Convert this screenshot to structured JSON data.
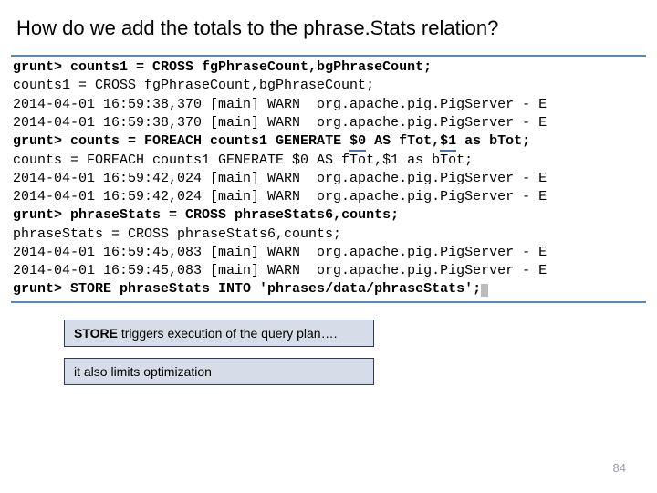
{
  "title": "How do we add the totals to the phrase.Stats relation?",
  "terminal": {
    "prompt": "grunt>",
    "lines": [
      {
        "t": "prompt",
        "cmd": " counts1 = CROSS fgPhraseCount,bgPhraseCount;"
      },
      {
        "t": "echo",
        "text": "counts1 = CROSS fgPhraseCount,bgPhraseCount;"
      },
      {
        "t": "log",
        "text": "2014-04-01 16:59:38,370 [main] WARN  org.apache.pig.PigServer - E"
      },
      {
        "t": "log",
        "text": "2014-04-01 16:59:38,370 [main] WARN  org.apache.pig.PigServer - E"
      },
      {
        "t": "prompt",
        "cmd": " counts = FOREACH counts1 GENERATE $0 AS fTot,$1 as bTot;"
      },
      {
        "t": "echo",
        "text": "counts = FOREACH counts1 GENERATE $0 AS fTot,$1 as bTot;"
      },
      {
        "t": "log",
        "text": "2014-04-01 16:59:42,024 [main] WARN  org.apache.pig.PigServer - E"
      },
      {
        "t": "log",
        "text": "2014-04-01 16:59:42,024 [main] WARN  org.apache.pig.PigServer - E"
      },
      {
        "t": "prompt",
        "cmd": " phraseStats = CROSS phraseStats6,counts;"
      },
      {
        "t": "echo",
        "text": "phraseStats = CROSS phraseStats6,counts;"
      },
      {
        "t": "log",
        "text": "2014-04-01 16:59:45,083 [main] WARN  org.apache.pig.PigServer - E"
      },
      {
        "t": "log",
        "text": "2014-04-01 16:59:45,083 [main] WARN  org.apache.pig.PigServer - E"
      },
      {
        "t": "prompt",
        "cmd": " STORE phraseStats INTO 'phrases/data/phraseStats';",
        "cursor": true
      }
    ]
  },
  "callouts": {
    "store_word": "STORE",
    "store_rest": " triggers execution of the query plan….",
    "limit": "it also limits optimization"
  },
  "page_number": "84"
}
